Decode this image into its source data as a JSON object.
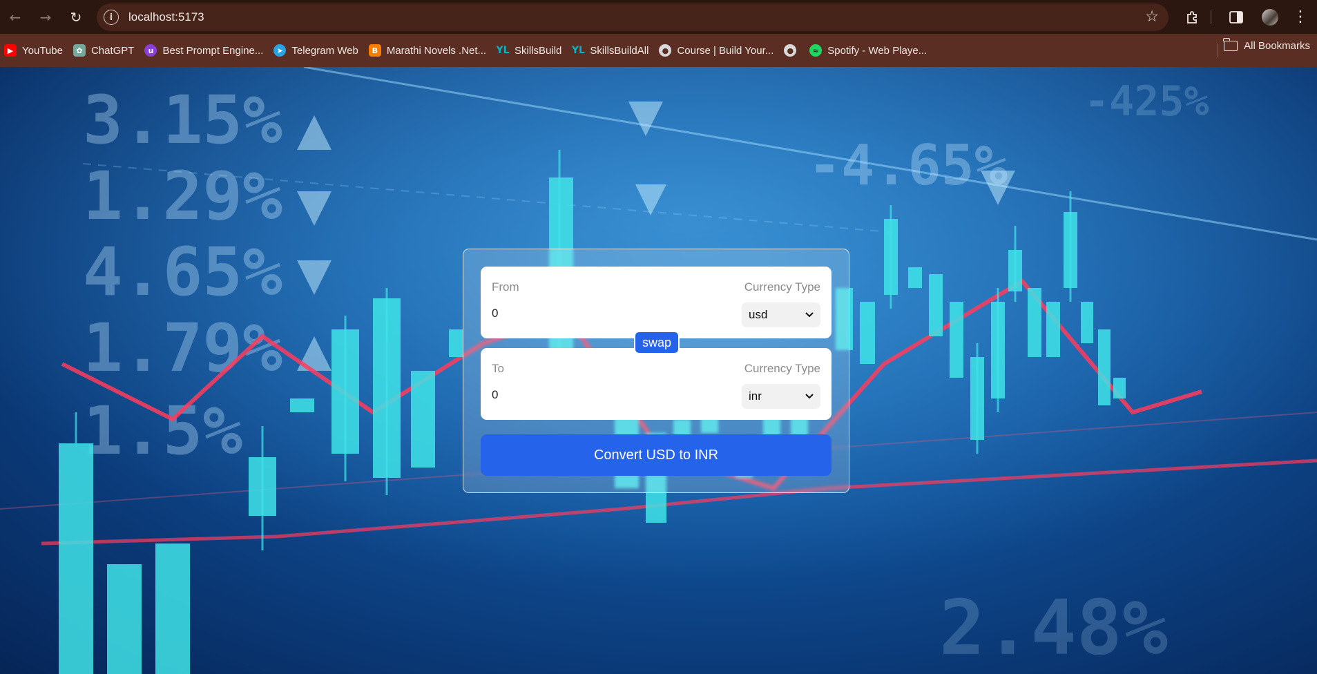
{
  "browser": {
    "url": "localhost:5173",
    "icons": {
      "back": "arrow-left-icon",
      "forward": "arrow-right-icon",
      "reload": "reload-icon",
      "site_info": "info-icon",
      "bookmark_star": "star-icon",
      "extensions": "puzzle-icon",
      "side_panel": "side-panel-icon",
      "menu": "kebab-menu-icon"
    }
  },
  "bookmarks": {
    "items": [
      {
        "label": "YouTube",
        "icon": "youtube-icon",
        "color": "#ff0000"
      },
      {
        "label": "ChatGPT",
        "icon": "chatgpt-icon",
        "color": "#74aa9c"
      },
      {
        "label": "Best Prompt Engine...",
        "icon": "prompt-icon",
        "color": "#8b3fd9"
      },
      {
        "label": "Telegram Web",
        "icon": "telegram-icon",
        "color": "#2aa3e0"
      },
      {
        "label": "Marathi Novels .Net...",
        "icon": "blogger-icon",
        "color": "#f57d00"
      },
      {
        "label": "SkillsBuild",
        "icon": "skillsbuild-icon",
        "color": "#00b5c8"
      },
      {
        "label": "SkillsBuildAll",
        "icon": "skillsbuild-icon",
        "color": "#00b5c8"
      },
      {
        "label": "Course | Build Your...",
        "icon": "globe-icon",
        "color": "#d9d9d9"
      },
      {
        "label": "",
        "icon": "globe-icon",
        "color": "#d9d9d9"
      },
      {
        "label": "Spotify - Web Playe...",
        "icon": "spotify-icon",
        "color": "#1ed760"
      }
    ],
    "all_bookmarks": "All Bookmarks"
  },
  "converter": {
    "from": {
      "label": "From",
      "currency_label": "Currency Type",
      "amount": "0",
      "currency": "usd"
    },
    "to": {
      "label": "To",
      "currency_label": "Currency Type",
      "amount": "0",
      "currency": "inr"
    },
    "swap_label": "swap",
    "convert_label": "Convert USD to INR",
    "accent_color": "#2563eb"
  }
}
